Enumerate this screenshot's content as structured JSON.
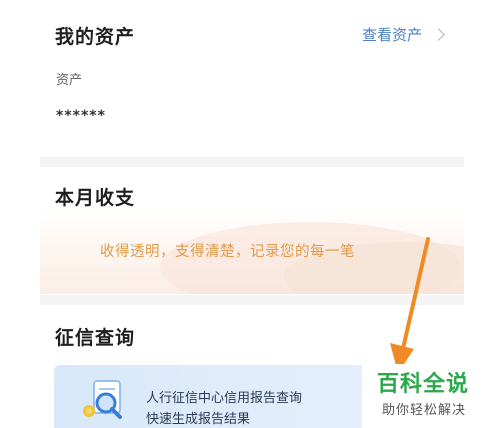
{
  "assets": {
    "title": "我的资产",
    "view_link": "查看资产",
    "label": "资产",
    "value": "******"
  },
  "monthly": {
    "title": "本月收支",
    "tagline": "收得透明，支得清楚，记录您的每一笔"
  },
  "credit": {
    "title": "征信查询",
    "card_line1": "人行征信中心信用报告查询",
    "card_line2": "快速生成报告结果"
  },
  "watermark": {
    "brand": "百科全说",
    "slogan": "助你轻松解决"
  },
  "colors": {
    "link": "#4a7fc8",
    "tagline": "#e29a4a",
    "arrow": "#f08a24",
    "watermark_brand": "#2aa84a"
  },
  "icons": {
    "chevron": "chevron-right-icon",
    "credit": "magnifier-report-icon",
    "annotation": "arrow-annotation"
  }
}
